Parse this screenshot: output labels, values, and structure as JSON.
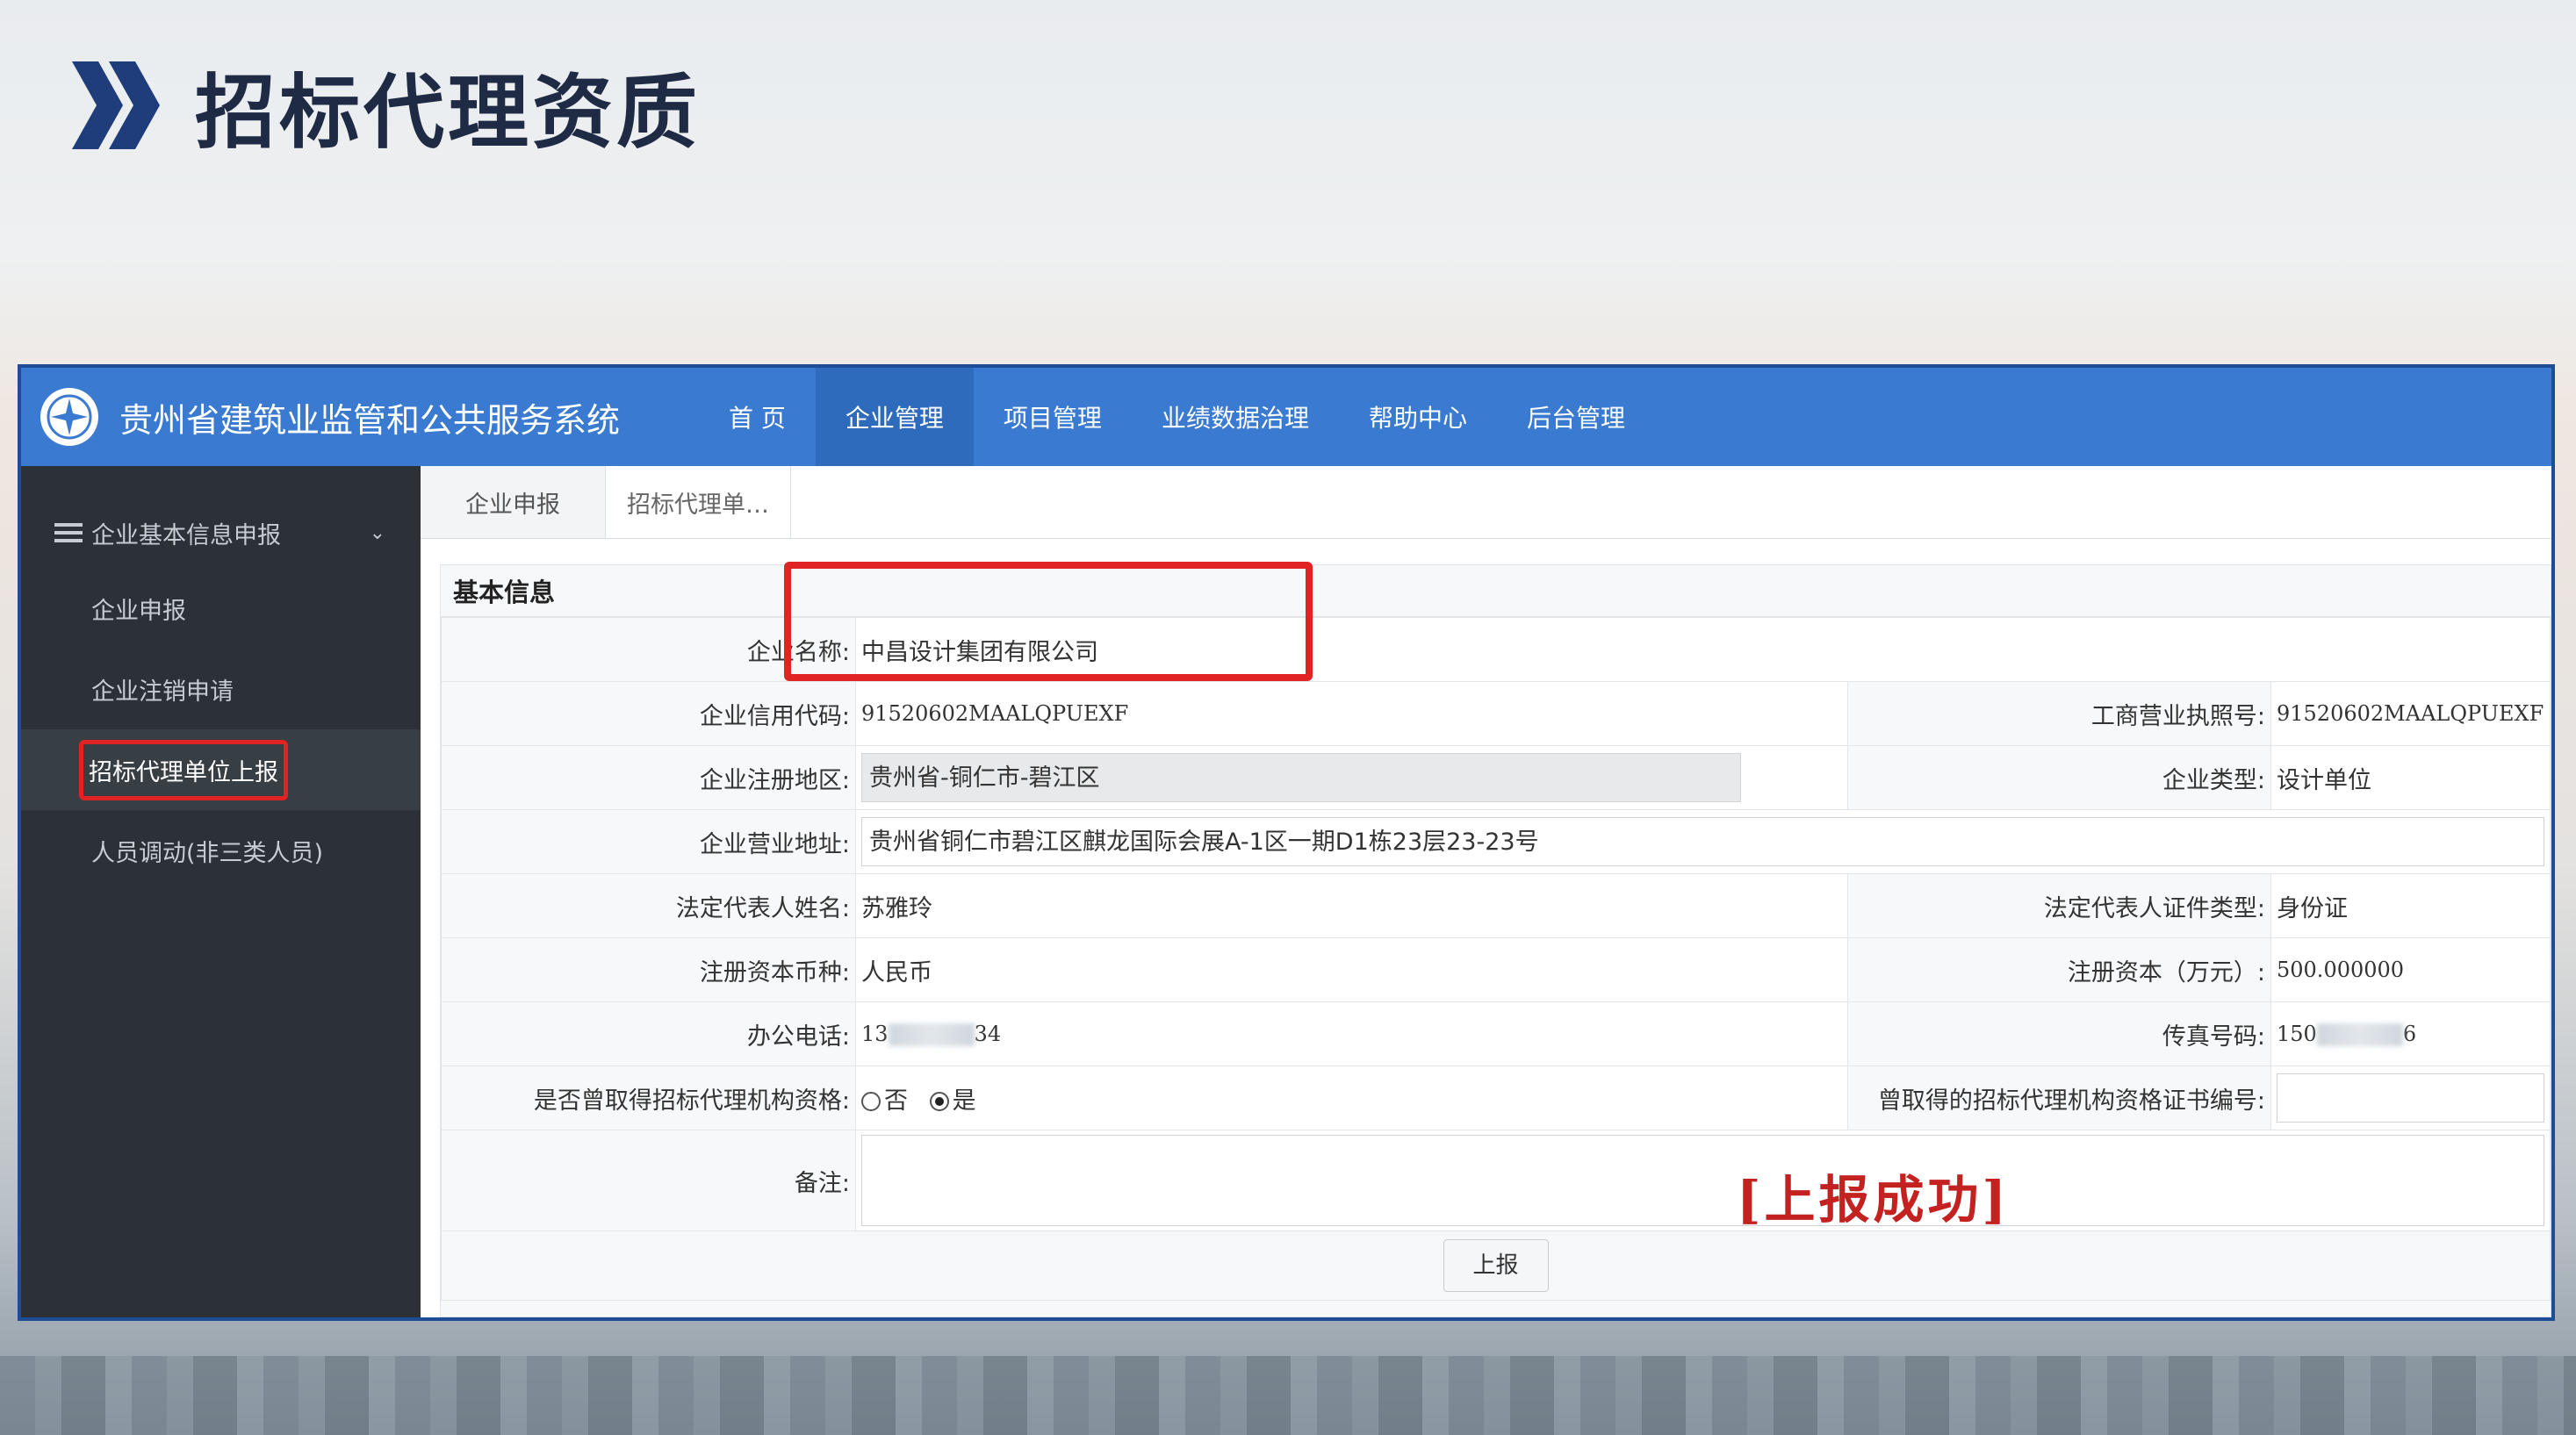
{
  "slide": {
    "title": "招标代理资质"
  },
  "app": {
    "system_name": "贵州省建筑业监管和公共服务系统",
    "nav": [
      "首 页",
      "企业管理",
      "项目管理",
      "业绩数据治理",
      "帮助中心",
      "后台管理"
    ],
    "nav_active": "企业管理",
    "sidebar": {
      "group": "企业基本信息申报",
      "items": [
        "企业申报",
        "企业注销申请",
        "招标代理单位上报",
        "人员调动(非三类人员)"
      ]
    },
    "tabs": [
      "企业申报",
      "招标代理单…"
    ],
    "section_title": "基本信息",
    "form": {
      "company_name_label": "企业名称:",
      "company_name": "中昌设计集团有限公司",
      "credit_code_label": "企业信用代码:",
      "credit_code": "91520602MAALQPUEXF",
      "license_no_label": "工商营业执照号:",
      "license_no": "91520602MAALQPUEXF",
      "reg_area_label": "企业注册地区:",
      "reg_area": "贵州省-铜仁市-碧江区",
      "company_type_label": "企业类型:",
      "company_type": "设计单位",
      "address_label": "企业营业地址:",
      "address": "贵州省铜仁市碧江区麒龙国际会展A-1区一期D1栋23层23-23号",
      "legal_rep_label": "法定代表人姓名:",
      "legal_rep": "苏雅玲",
      "id_type_label": "法定代表人证件类型:",
      "id_type": "身份证",
      "currency_label": "注册资本币种:",
      "currency": "人民币",
      "capital_label": "注册资本（万元）:",
      "capital": "500.000000",
      "phone_label": "办公电话:",
      "phone_prefix": "13",
      "phone_suffix": "34",
      "fax_label": "传真号码:",
      "fax_prefix": "150",
      "fax_suffix": "6",
      "qualified_label": "是否曾取得招标代理机构资格:",
      "qualified_no": "否",
      "qualified_yes": "是",
      "qualified_selected": "是",
      "cert_no_label": "曾取得的招标代理机构资格证书编号:",
      "remark_label": "备注:",
      "submit": "上报"
    },
    "success_stamp": "[上报成功]"
  },
  "colors": {
    "topbar": "#3a7bd1",
    "sidebar": "#2b3136",
    "highlight": "#e02424",
    "stamp": "#c42121",
    "title": "#1f2a44"
  }
}
